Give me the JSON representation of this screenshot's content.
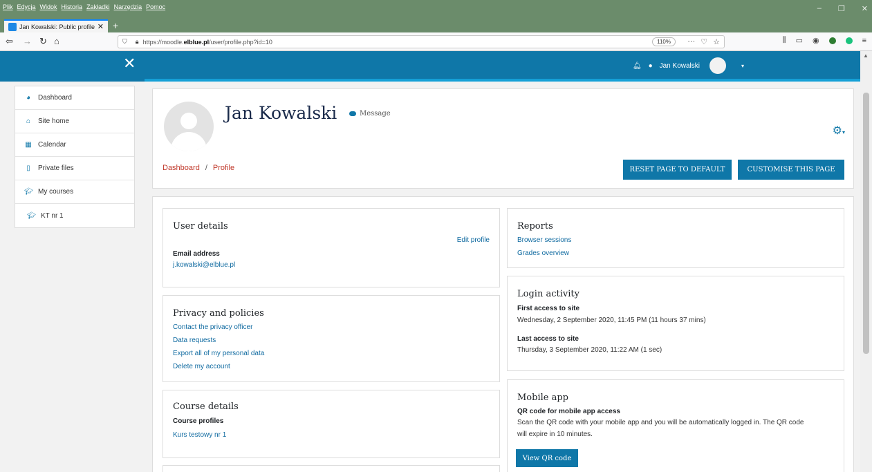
{
  "browser": {
    "menus": [
      "Plik",
      "Edycja",
      "Widok",
      "Historia",
      "Zakładki",
      "Narzędzia",
      "Pomoc"
    ],
    "tab_title": "Jan Kowalski: Public profile",
    "url_prefix": "https://moodle.",
    "url_host": "elblue.pl",
    "url_path": "/user/profile.php?id=10",
    "zoom": "110%",
    "url_more": "···"
  },
  "topbar": {
    "user_name": "Jan Kowalski"
  },
  "nav": {
    "items": [
      {
        "label": "Dashboard"
      },
      {
        "label": "Site home"
      },
      {
        "label": "Calendar"
      },
      {
        "label": "Private files"
      },
      {
        "label": "My courses"
      },
      {
        "label": "KT nr 1"
      }
    ]
  },
  "header": {
    "name": "Jan Kowalski",
    "message_label": "Message",
    "breadcrumb": [
      "Dashboard",
      "Profile"
    ],
    "breadcrumb_sep": "/",
    "reset_button": "RESET PAGE TO DEFAULT",
    "customise_button": "CUSTOMISE THIS PAGE"
  },
  "user_details": {
    "title": "User details",
    "edit_link": "Edit profile",
    "email_label": "Email address",
    "email_value": "j.kowalski@elblue.pl"
  },
  "privacy": {
    "title": "Privacy and policies",
    "links": [
      "Contact the privacy officer",
      "Data requests",
      "Export all of my personal data",
      "Delete my account"
    ]
  },
  "course_details": {
    "title": "Course details",
    "profiles_label": "Course profiles",
    "course_link": "Kurs testowy nr 1"
  },
  "reports": {
    "title": "Reports",
    "links": [
      "Browser sessions",
      "Grades overview"
    ]
  },
  "login_activity": {
    "title": "Login activity",
    "first_label": "First access to site",
    "first_value": "Wednesday, 2 September 2020, 11:45 PM  (11 hours 37 mins)",
    "last_label": "Last access to site",
    "last_value": "Thursday, 3 September 2020, 11:22 AM  (1 sec)"
  },
  "mobile_app": {
    "title": "Mobile app",
    "qr_label": "QR code for mobile app access",
    "qr_text_line1": "Scan the QR code with your mobile app and you will be automatically logged in. The QR code",
    "qr_text_line2": "will expire in 10 minutes.",
    "qr_button": "View QR code"
  }
}
